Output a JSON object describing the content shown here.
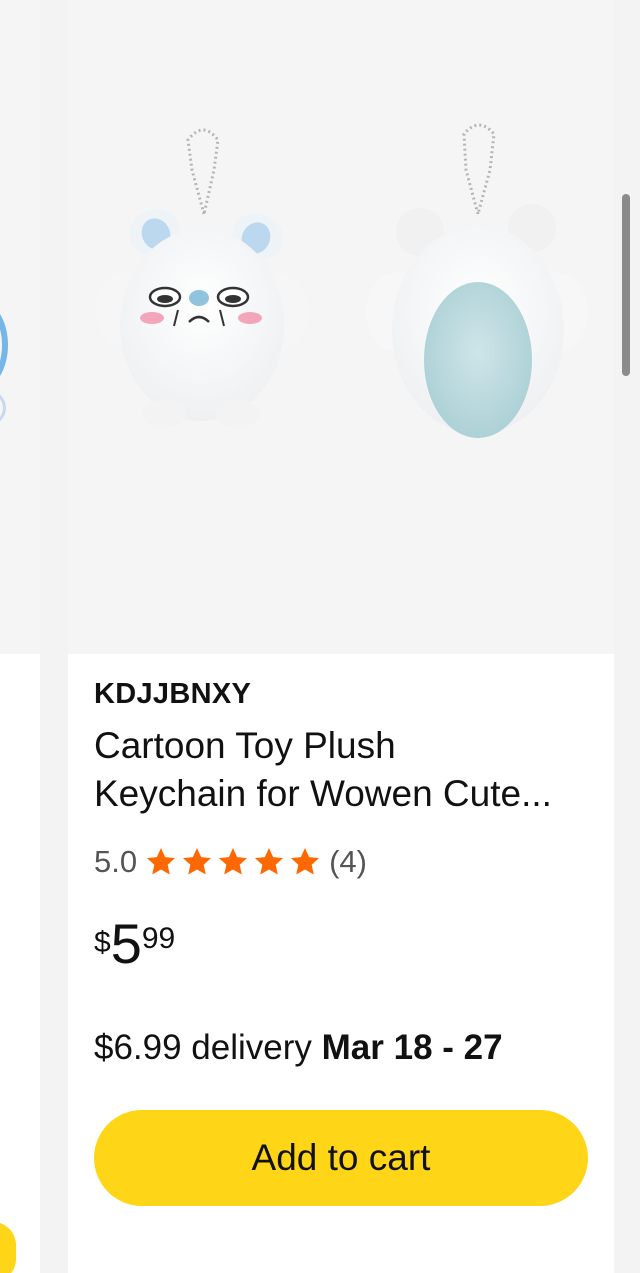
{
  "product": {
    "brand": "KDJJBNXY",
    "title_line1": "Cartoon Toy Plush",
    "title_line2": "Keychain for Wowen Cute...",
    "rating_value": "5.0",
    "stars": 5,
    "review_count": "(4)",
    "price_currency": "$",
    "price_dollars": "5",
    "price_cents": "99",
    "delivery_fee": "$6.99 delivery",
    "delivery_dates": "Mar 18 - 27",
    "add_to_cart_label": "Add to cart"
  },
  "colors": {
    "accent_yellow": "#ffd518",
    "star_orange": "#ff6700",
    "image_bg": "#f5f5f5"
  },
  "icons": [
    "star-icon",
    "plush-front-image",
    "plush-back-image"
  ]
}
